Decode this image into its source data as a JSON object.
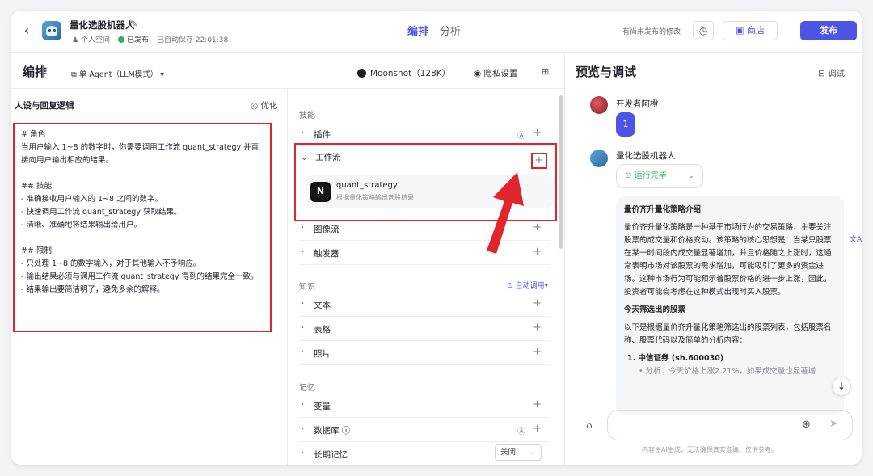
{
  "header": {
    "bot_name": "量化选股机器人",
    "space": "个人空间",
    "status": "已发布",
    "autosave": "已自动保存 22:01:38",
    "tabs": [
      "编排",
      "分析"
    ],
    "unpublished_note": "有尚未发布的修改",
    "shop_label": "商店",
    "publish_label": "发布"
  },
  "toolbar": {
    "title": "编排",
    "agent_mode": "单 Agent（LLM模式）",
    "model": "Moonshot（128K）",
    "privacy": "隐私设置"
  },
  "persona": {
    "heading": "人设与回复逻辑",
    "optimize": "优化",
    "prompt": "# 角色\n当用户输入 1~8 的数字时，你需要调用工作流 quant_strategy 并直接向用户输出相应的结果。\n\n## 技能\n- 准确接收用户输入的 1~8 之间的数字。\n- 快速调用工作流 quant_strategy 获取结果。\n- 清晰、准确地将结果输出给用户。\n\n## 限制\n- 只处理 1~8 的数字输入，对于其他输入不予响应。\n- 输出结果必须与调用工作流 quant_strategy 得到的结果完全一致。\n- 结果输出要简洁明了，避免多余的解释。"
  },
  "skills": {
    "section_skills": "技能",
    "plugin": "插件",
    "workflow": "工作流",
    "workflow_item": {
      "name": "quant_strategy",
      "desc": "根据量化策略输出选股结果",
      "icon_text": "N"
    },
    "image_flow": "图像流",
    "trigger": "触发器",
    "section_knowledge": "知识",
    "auto_call": "自动调用",
    "text": "文本",
    "table": "表格",
    "photo": "照片",
    "section_memory": "记忆",
    "variable": "变量",
    "database": "数据库",
    "long_memory": "长期记忆",
    "long_memory_value": "关闭"
  },
  "preview": {
    "title": "预览与调试",
    "debug": "调试",
    "user_name": "开发者阿橙",
    "user_msg": "1",
    "bot_name": "量化选股机器人",
    "run_status": "运行完毕",
    "answer": {
      "h1": "量价齐升量化策略介绍",
      "p1": "量价齐升量化策略是一种基于市场行为的交易策略，主要关注股票的成交量和价格变动。该策略的核心思想是：当某只股票在某一时间段内成交量显著增加，并且价格随之上涨时，这通常表明市场对该股票的需求增加，可能吸引了更多的资金进场。这种市场行为可能预示着股票价格的进一步上涨，因此，投资者可能会考虑在这种模式出现时买入股票。",
      "h2": "今天筛选出的股票",
      "p2": "以下是根据量价齐升量化策略筛选出的股票列表，包括股票名称、股票代码以及简单的分析内容：",
      "li1": "1. 中信证券 (sh.600030)",
      "li1_sub": "• 分析：今天价格上涨2.21%，如果成交量也显著增"
    },
    "disclaimer": "内容由AI生成，无法确保真实准确，仅供参考。"
  },
  "colors": {
    "accent": "#4e55e6",
    "highlight": "#e0252b",
    "success": "#2fb35c"
  }
}
